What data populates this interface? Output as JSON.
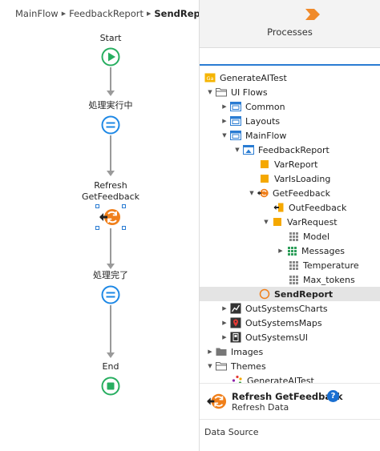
{
  "breadcrumb": {
    "items": [
      "MainFlow",
      "FeedbackReport"
    ],
    "current": "SendReport"
  },
  "flow": {
    "start_label": "Start",
    "assign1_label": "処理実行中",
    "action_label_line1": "Refresh",
    "action_label_line2": "GetFeedback",
    "assign2_label": "処理完了",
    "end_label": "End",
    "colors": {
      "start": "#27ae60",
      "assign": "#1e88e5",
      "action": "#f07f1a",
      "connector": "#9a9a9a"
    }
  },
  "panel": {
    "title": "Processes",
    "tree": [
      {
        "label": "GenerateAITest",
        "icon": "module-icon"
      },
      {
        "label": "UI Flows",
        "icon": "folder-open-icon",
        "expanded": true
      },
      {
        "label": "Common",
        "icon": "ui-flow-icon",
        "expanded": false
      },
      {
        "label": "Layouts",
        "icon": "ui-flow-icon",
        "expanded": false
      },
      {
        "label": "MainFlow",
        "icon": "ui-flow-icon",
        "expanded": true
      },
      {
        "label": "FeedbackReport",
        "icon": "screen-icon",
        "expanded": true
      },
      {
        "label": "VarReport",
        "icon": "variable-icon"
      },
      {
        "label": "VarIsLoading",
        "icon": "variable-icon"
      },
      {
        "label": "GetFeedback",
        "icon": "data-action-icon",
        "expanded": true
      },
      {
        "label": "OutFeedback",
        "icon": "output-parameter-icon"
      },
      {
        "label": "VarRequest",
        "icon": "variable-icon",
        "expanded": true
      },
      {
        "label": "Model",
        "icon": "attribute-icon"
      },
      {
        "label": "Messages",
        "icon": "list-attribute-icon",
        "expanded": false
      },
      {
        "label": "Temperature",
        "icon": "attribute-icon"
      },
      {
        "label": "Max_tokens",
        "icon": "attribute-icon"
      },
      {
        "label": "SendReport",
        "icon": "client-action-icon",
        "selected": true
      },
      {
        "label": "OutSystemsCharts",
        "icon": "charts-module-icon",
        "expanded": false
      },
      {
        "label": "OutSystemsMaps",
        "icon": "maps-module-icon",
        "expanded": false
      },
      {
        "label": "OutSystemsUI",
        "icon": "ui-module-icon",
        "expanded": false
      },
      {
        "label": "Images",
        "icon": "folder-icon",
        "expanded": false
      },
      {
        "label": "Themes",
        "icon": "folder-open-icon",
        "expanded": true
      },
      {
        "label": "GenerateAITest",
        "icon": "theme-icon"
      }
    ]
  },
  "detail": {
    "title": "Refresh GetFeedback",
    "subtitle": "Refresh Data",
    "help": "?"
  },
  "data_source_label": "Data Source"
}
